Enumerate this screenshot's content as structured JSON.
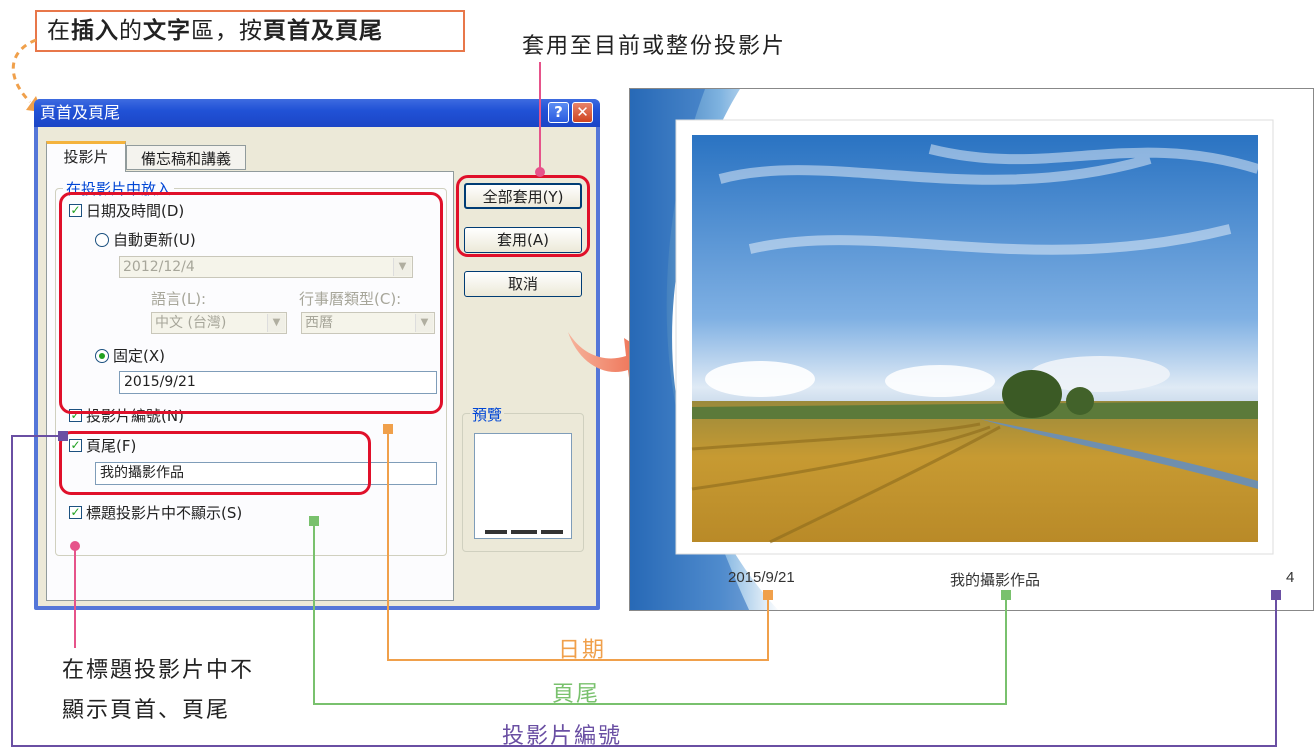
{
  "annotations": {
    "instruction_parts": [
      "在",
      "插入",
      "的",
      "文字",
      "區，按",
      "頁首及頁尾"
    ],
    "apply_note": "套用至目前或整份投影片",
    "title_slide_note_line1": "在標題投影片中不",
    "title_slide_note_line2": "顯示頁首、頁尾",
    "date_caption": "日期",
    "footer_caption": "頁尾",
    "slide_number_caption": "投影片編號"
  },
  "dialog": {
    "title": "頁首及頁尾",
    "help_label": "?",
    "close_label": "✕",
    "tabs": [
      {
        "label": "投影片",
        "active": true
      },
      {
        "label": "備忘稿和講義",
        "active": false
      }
    ],
    "group_label": "在投影片中放入",
    "date_time_label": "日期及時間(D)",
    "date_time_checked": true,
    "auto_update_label": "自動更新(U)",
    "auto_update_value": "2012/12/4",
    "language_label": "語言(L):",
    "language_value": "中文 (台灣)",
    "calendar_label": "行事曆類型(C):",
    "calendar_value": "西曆",
    "fixed_label": "固定(X)",
    "fixed_value": "2015/9/21",
    "slide_number_label": "投影片編號(N)",
    "slide_number_checked": true,
    "footer_label": "頁尾(F)",
    "footer_checked": true,
    "footer_value": "我的攝影作品",
    "hide_on_title_label": "標題投影片中不顯示(S)",
    "hide_on_title_checked": true,
    "buttons": {
      "apply_all": "全部套用(Y)",
      "apply": "套用(A)",
      "cancel": "取消"
    },
    "preview_label": "預覽"
  },
  "slide": {
    "date": "2015/9/21",
    "footer": "我的攝影作品",
    "number": "4"
  },
  "colors": {
    "orange": "#f0a04b",
    "green": "#79c16d",
    "purple": "#6a4fa3",
    "pink": "#e6538a",
    "red_highlight": "#e0102a",
    "title_bar": "#2152d6"
  }
}
